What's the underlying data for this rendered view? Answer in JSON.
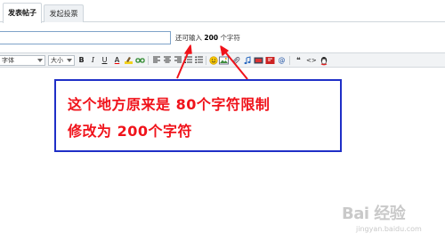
{
  "tabs": [
    {
      "label": "发表帖子",
      "active": true
    },
    {
      "label": "发起投票",
      "active": false
    }
  ],
  "title_field": {
    "value": "",
    "placeholder": ""
  },
  "counter": {
    "prefix": "还可输入",
    "count": "200",
    "suffix": "个字符"
  },
  "toolbar": {
    "font_select": "字体",
    "size_select": "大小",
    "bold": "B",
    "italic": "I",
    "underline": "U",
    "font_color": "A",
    "quote": "❝",
    "code": "<>",
    "icons": [
      "bold-icon",
      "italic-icon",
      "underline-icon",
      "font-color-icon",
      "highlight-icon",
      "link-icon",
      "align-left-icon",
      "align-center-icon",
      "align-right-icon",
      "ordered-list-icon",
      "unordered-list-icon",
      "emoticon-icon",
      "image-icon",
      "attachment-icon",
      "music-icon",
      "video-icon",
      "flash-icon",
      "email-icon",
      "quote-icon",
      "code-icon",
      "qq-icon"
    ]
  },
  "annotation": {
    "line1": "这个地方原来是  80个字符限制",
    "line2": "修改为 200个字符",
    "text_color": "#f0131b",
    "border_color": "#1f2fc7"
  },
  "watermark": {
    "logo": "Bai 经验",
    "url": "jingyan.baidu.com"
  }
}
